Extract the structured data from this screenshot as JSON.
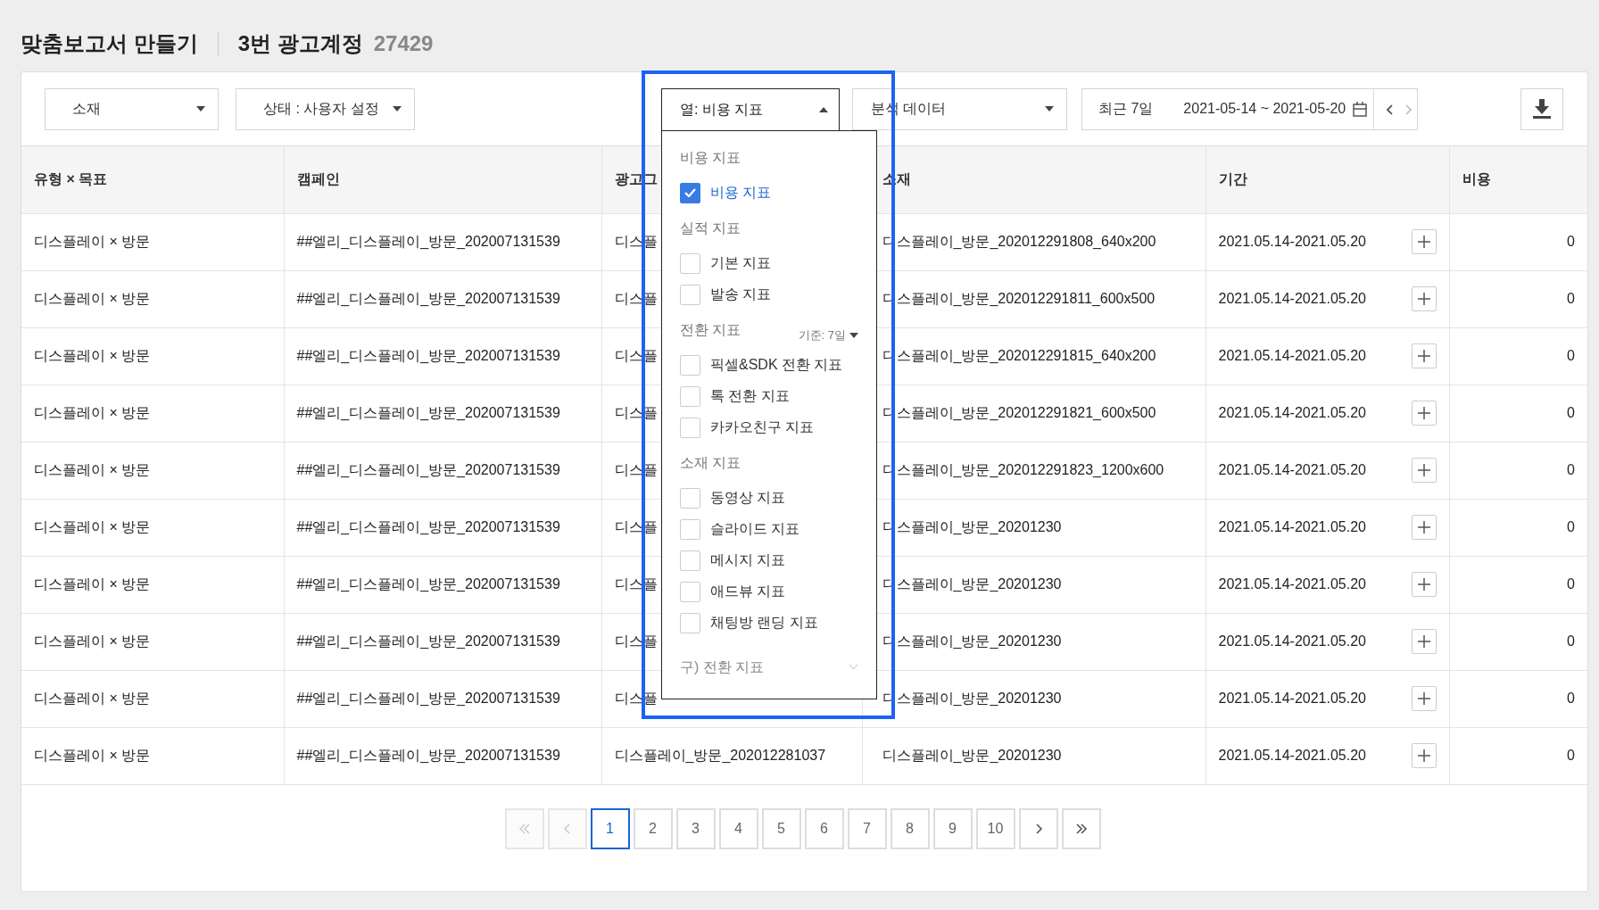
{
  "header": {
    "title": "맞춤보고서 만들기",
    "account": "3번 광고계정",
    "account_id": "27429"
  },
  "toolbar": {
    "selects": [
      {
        "label": "소재"
      },
      {
        "label": "상태 : 사용자 설정"
      }
    ],
    "column_dropdown": {
      "label": "열: 비용 지표",
      "expanded": true
    },
    "analysis_select": {
      "label": "분석 데이터"
    },
    "date": {
      "preset": "최근 7일",
      "range": "2021-05-14 ~ 2021-05-20"
    }
  },
  "table": {
    "columns": [
      "유형 × 목표",
      "캠페인",
      "광고그",
      "소재",
      "기간",
      "비용"
    ],
    "rows": [
      {
        "type_goal": "디스플레이 × 방문",
        "campaign": "##엘리_디스플레이_방문_202007131539",
        "ad_group": "디스플",
        "creative": "디스플레이_방문_202012291808_640x200",
        "period": "2021.05.14-2021.05.20",
        "cost": "0"
      },
      {
        "type_goal": "디스플레이 × 방문",
        "campaign": "##엘리_디스플레이_방문_202007131539",
        "ad_group": "디스플",
        "creative": "디스플레이_방문_202012291811_600x500",
        "period": "2021.05.14-2021.05.20",
        "cost": "0"
      },
      {
        "type_goal": "디스플레이 × 방문",
        "campaign": "##엘리_디스플레이_방문_202007131539",
        "ad_group": "디스플",
        "creative": "디스플레이_방문_202012291815_640x200",
        "period": "2021.05.14-2021.05.20",
        "cost": "0"
      },
      {
        "type_goal": "디스플레이 × 방문",
        "campaign": "##엘리_디스플레이_방문_202007131539",
        "ad_group": "디스플",
        "creative": "디스플레이_방문_202012291821_600x500",
        "period": "2021.05.14-2021.05.20",
        "cost": "0"
      },
      {
        "type_goal": "디스플레이 × 방문",
        "campaign": "##엘리_디스플레이_방문_202007131539",
        "ad_group": "디스플",
        "creative": "디스플레이_방문_202012291823_1200x600",
        "period": "2021.05.14-2021.05.20",
        "cost": "0"
      },
      {
        "type_goal": "디스플레이 × 방문",
        "campaign": "##엘리_디스플레이_방문_202007131539",
        "ad_group": "디스플",
        "creative": "디스플레이_방문_20201230",
        "period": "2021.05.14-2021.05.20",
        "cost": "0"
      },
      {
        "type_goal": "디스플레이 × 방문",
        "campaign": "##엘리_디스플레이_방문_202007131539",
        "ad_group": "디스플",
        "creative": "디스플레이_방문_20201230",
        "period": "2021.05.14-2021.05.20",
        "cost": "0"
      },
      {
        "type_goal": "디스플레이 × 방문",
        "campaign": "##엘리_디스플레이_방문_202007131539",
        "ad_group": "디스플",
        "creative": "디스플레이_방문_20201230",
        "period": "2021.05.14-2021.05.20",
        "cost": "0"
      },
      {
        "type_goal": "디스플레이 × 방문",
        "campaign": "##엘리_디스플레이_방문_202007131539",
        "ad_group": "디스플",
        "creative": "디스플레이_방문_20201230",
        "period": "2021.05.14-2021.05.20",
        "cost": "0"
      },
      {
        "type_goal": "디스플레이 × 방문",
        "campaign": "##엘리_디스플레이_방문_202007131539",
        "ad_group": "디스플레이_방문_202012281037",
        "creative": "디스플레이_방문_20201230",
        "period": "2021.05.14-2021.05.20",
        "cost": "0"
      }
    ]
  },
  "column_menu": {
    "groups": [
      {
        "title": "비용 지표",
        "items": [
          {
            "label": "비용 지표",
            "checked": true
          }
        ]
      },
      {
        "title": "실적 지표",
        "items": [
          {
            "label": "기본 지표",
            "checked": false
          },
          {
            "label": "발송 지표",
            "checked": false
          }
        ]
      },
      {
        "title": "전환 지표",
        "basis": "기준: 7일",
        "items": [
          {
            "label": "픽셀&SDK 전환 지표",
            "checked": false
          },
          {
            "label": "톡 전환 지표",
            "checked": false
          },
          {
            "label": "카카오친구 지표",
            "checked": false
          }
        ]
      },
      {
        "title": "소재 지표",
        "items": [
          {
            "label": "동영상 지표",
            "checked": false
          },
          {
            "label": "슬라이드 지표",
            "checked": false
          },
          {
            "label": "메시지 지표",
            "checked": false
          },
          {
            "label": "애드뷰 지표",
            "checked": false
          },
          {
            "label": "채팅방 랜딩 지표",
            "checked": false
          }
        ]
      }
    ],
    "collapsed_group": {
      "title": "구) 전환 지표",
      "expanded": false
    }
  },
  "pagination": {
    "items": [
      {
        "kind": "first",
        "disabled": true
      },
      {
        "kind": "prev",
        "disabled": true
      },
      {
        "kind": "page",
        "label": "1",
        "selected": true
      },
      {
        "kind": "page",
        "label": "2",
        "selected": false
      },
      {
        "kind": "page",
        "label": "3",
        "selected": false
      },
      {
        "kind": "page",
        "label": "4",
        "selected": false
      },
      {
        "kind": "page",
        "label": "5",
        "selected": false
      },
      {
        "kind": "page",
        "label": "6",
        "selected": false
      },
      {
        "kind": "page",
        "label": "7",
        "selected": false
      },
      {
        "kind": "page",
        "label": "8",
        "selected": false
      },
      {
        "kind": "page",
        "label": "9",
        "selected": false
      },
      {
        "kind": "page",
        "label": "10",
        "selected": false
      },
      {
        "kind": "next",
        "disabled": false
      },
      {
        "kind": "last",
        "disabled": false
      }
    ]
  }
}
